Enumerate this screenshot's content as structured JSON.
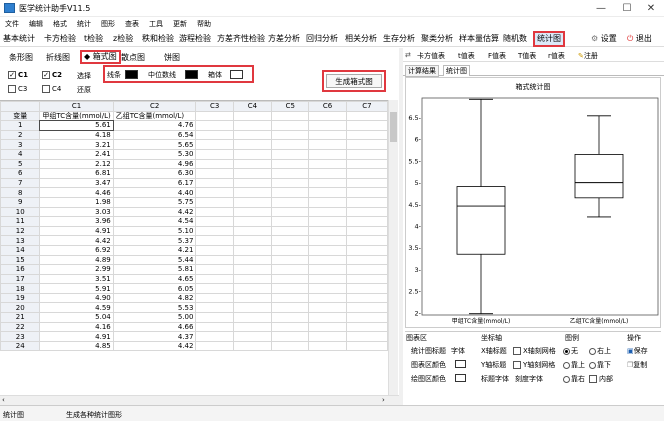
{
  "window": {
    "title": "医学统计助手V11.5"
  },
  "menu": [
    "文件",
    "编辑",
    "格式",
    "统计",
    "图形",
    "查表",
    "工具",
    "更新",
    "帮助"
  ],
  "toolbar": {
    "items": [
      "基本统计",
      "卡方检验",
      "t检验",
      "z检验",
      "秩和检验",
      "游程检验",
      "方差齐性检验",
      "方差分析",
      "回归分析",
      "相关分析",
      "生存分析",
      "聚类分析",
      "样本量估算",
      "随机数",
      "统计图"
    ],
    "active": "统计图",
    "settings": "设置",
    "exit": "退出"
  },
  "chart_tabs": [
    "条形图",
    "折线图",
    "箱式图",
    "散点图",
    "饼图"
  ],
  "active_chart_tab": "箱式图",
  "columns_select": {
    "c1": "C1",
    "c2": "C2",
    "c3": "C3",
    "c4": "C4",
    "select": "选择",
    "restore": "还原"
  },
  "style_options": {
    "line": "线条",
    "median": "中位数线",
    "box": "箱体"
  },
  "generate_button": "生成箱式图",
  "grid": {
    "col_headers": [
      "C1",
      "C2",
      "C3",
      "C4",
      "C5",
      "C6",
      "C7"
    ],
    "variable_label": "变量",
    "c1_name": "甲组TC含量(mmol/L)",
    "c2_name": "乙组TC含量(mmol/L)",
    "rows": [
      [
        "1",
        "5.61",
        "4.76"
      ],
      [
        "2",
        "4.18",
        "6.54"
      ],
      [
        "3",
        "3.21",
        "5.65"
      ],
      [
        "4",
        "2.41",
        "5.30"
      ],
      [
        "5",
        "2.12",
        "4.96"
      ],
      [
        "6",
        "6.81",
        "6.30"
      ],
      [
        "7",
        "3.47",
        "6.17"
      ],
      [
        "8",
        "4.46",
        "4.40"
      ],
      [
        "9",
        "1.98",
        "5.75"
      ],
      [
        "10",
        "3.03",
        "4.42"
      ],
      [
        "11",
        "3.96",
        "4.54"
      ],
      [
        "12",
        "4.91",
        "5.10"
      ],
      [
        "13",
        "4.42",
        "5.37"
      ],
      [
        "14",
        "6.92",
        "4.21"
      ],
      [
        "15",
        "4.89",
        "5.44"
      ],
      [
        "16",
        "2.99",
        "5.81"
      ],
      [
        "17",
        "3.51",
        "4.65"
      ],
      [
        "18",
        "5.91",
        "6.05"
      ],
      [
        "19",
        "4.90",
        "4.82"
      ],
      [
        "20",
        "4.59",
        "5.53"
      ],
      [
        "21",
        "5.04",
        "5.00"
      ],
      [
        "22",
        "4.16",
        "4.66"
      ],
      [
        "23",
        "4.91",
        "4.37"
      ],
      [
        "24",
        "4.85",
        "4.42"
      ]
    ]
  },
  "right_toolbar": {
    "items": [
      "卡方值表",
      "t值表",
      "F值表",
      "T值表",
      "r值表",
      "注册"
    ]
  },
  "right_tabs": [
    "计算结果",
    "统计图"
  ],
  "active_right_tab": "统计图",
  "chart_data": {
    "type": "box",
    "title": "箱式统计图",
    "categories": [
      "甲组TC含量(mmol/L)",
      "乙组TC含量(mmol/L)"
    ],
    "boxes": [
      {
        "min": 1.98,
        "q1": 3.35,
        "median": 4.46,
        "q3": 4.91,
        "max": 6.92
      },
      {
        "min": 4.21,
        "q1": 4.65,
        "median": 5.0,
        "q3": 5.65,
        "max": 6.54
      }
    ],
    "y_ticks": [
      "6.5-",
      "6-",
      "5.5-",
      "5-",
      "4.5-",
      "4-",
      "3.5-",
      "3-",
      "2.5-",
      "2-"
    ],
    "y_values": [
      6.5,
      6,
      5.5,
      5,
      4.5,
      4,
      3.5,
      3,
      2.5,
      2
    ],
    "ylim": [
      1.95,
      6.95
    ]
  },
  "settings_panel": {
    "chart_area": "图表区",
    "stat_title": "统计图标题",
    "font": "字体",
    "chart_color": "图表区颜色",
    "plot_color": "绘图区颜色",
    "axes": "坐标轴",
    "x_title": "X轴标题",
    "x_grid": "X轴刻网格",
    "y_title": "Y轴标题",
    "y_grid": "Y轴刻网格",
    "title_font": "标题字体",
    "tick_font": "刻度字体",
    "legend": "图例",
    "none": "无",
    "top_right": "右上",
    "top_left": "靠上",
    "bottom": "靠下",
    "right": "靠右",
    "inner": "内部",
    "ops": "操作",
    "save": "保存",
    "copy": "复制"
  },
  "status": {
    "left": "统计图",
    "message": "生成各种统计图形"
  }
}
